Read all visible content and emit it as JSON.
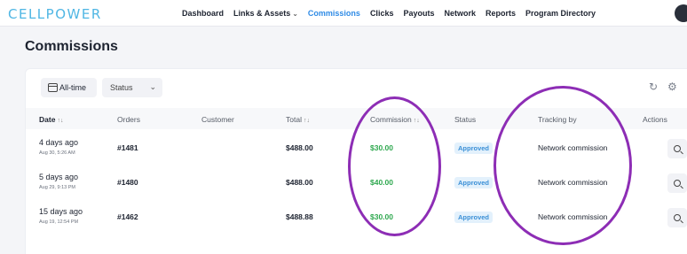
{
  "brand": {
    "logo": "CELLPOWER",
    "accent": "#2f8be6",
    "logo_color": "#4fb6e4"
  },
  "nav": {
    "items": [
      {
        "label": "Dashboard",
        "active": false
      },
      {
        "label": "Links & Assets",
        "active": false,
        "has_dropdown": true
      },
      {
        "label": "Commissions",
        "active": true
      },
      {
        "label": "Clicks",
        "active": false
      },
      {
        "label": "Payouts",
        "active": false
      },
      {
        "label": "Network",
        "active": false
      },
      {
        "label": "Reports",
        "active": false
      },
      {
        "label": "Program Directory",
        "active": false
      }
    ]
  },
  "page": {
    "title": "Commissions"
  },
  "filters": {
    "date_range": "All-time",
    "status_value": "Status",
    "icons": [
      "calendar-icon",
      "chevron-down-icon",
      "refresh-icon",
      "settings-icon"
    ]
  },
  "table": {
    "columns": {
      "date": "Date",
      "orders": "Orders",
      "customer": "Customer",
      "total": "Total",
      "commission": "Commission",
      "status": "Status",
      "tracking": "Tracking by",
      "actions": "Actions"
    },
    "sort_glyph": "↑↓",
    "rows": [
      {
        "date": "4 days ago",
        "date_detail": "Aug 30, 5:26 AM",
        "order": "#1481",
        "customer": "",
        "total": "$488.00",
        "commission": "$30.00",
        "status": "Approved",
        "tracking": "Network commission"
      },
      {
        "date": "5 days ago",
        "date_detail": "Aug 29, 9:13 PM",
        "order": "#1480",
        "customer": "",
        "total": "$488.00",
        "commission": "$40.00",
        "status": "Approved",
        "tracking": "Network commission"
      },
      {
        "date": "15 days ago",
        "date_detail": "Aug 19, 12:54 PM",
        "order": "#1462",
        "customer": "",
        "total": "$488.88",
        "commission": "$30.00",
        "status": "Approved",
        "tracking": "Network commission"
      }
    ]
  },
  "annotations": {
    "circle_color": "#8d2db5"
  }
}
